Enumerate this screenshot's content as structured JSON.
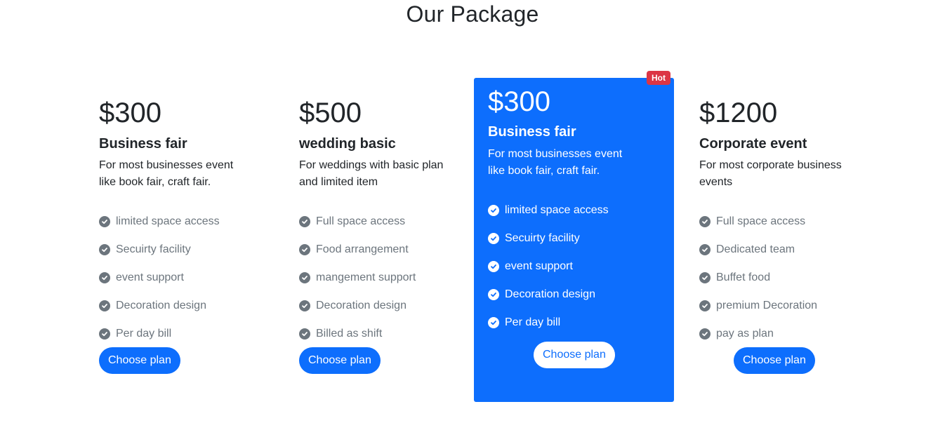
{
  "section": {
    "title": "Our Package"
  },
  "colors": {
    "primary": "#0d6efd",
    "hot": "#dc3545",
    "muted": "#6c757d",
    "text": "#212529"
  },
  "plans": [
    {
      "price": "$300",
      "name": "Business fair",
      "description": "For most businesses event like book fair, craft fair.",
      "features": [
        "limited space access",
        "Secuirty facility",
        "event support",
        "Decoration design",
        "Per day bill"
      ],
      "button_label": "Choose plan",
      "highlighted": false
    },
    {
      "price": "$500",
      "name": "wedding basic",
      "description": "For weddings with basic plan and limited item",
      "features": [
        "Full space access",
        "Food arrangement",
        "mangement support",
        "Decoration design",
        "Billed as shift"
      ],
      "button_label": "Choose plan",
      "highlighted": false
    },
    {
      "price": "$300",
      "name": "Business fair",
      "description": "For most businesses event like book fair, craft fair.",
      "features": [
        "limited space access",
        "Secuirty facility",
        "event support",
        "Decoration design",
        "Per day bill"
      ],
      "button_label": "Choose plan",
      "highlighted": true,
      "badge": "Hot"
    },
    {
      "price": "$1200",
      "name": "Corporate event",
      "description": "For most corporate business events",
      "features": [
        "Full space access",
        "Dedicated team",
        "Buffet food",
        "premium Decoration",
        "pay as plan"
      ],
      "button_label": "Choose plan",
      "highlighted": false
    }
  ]
}
